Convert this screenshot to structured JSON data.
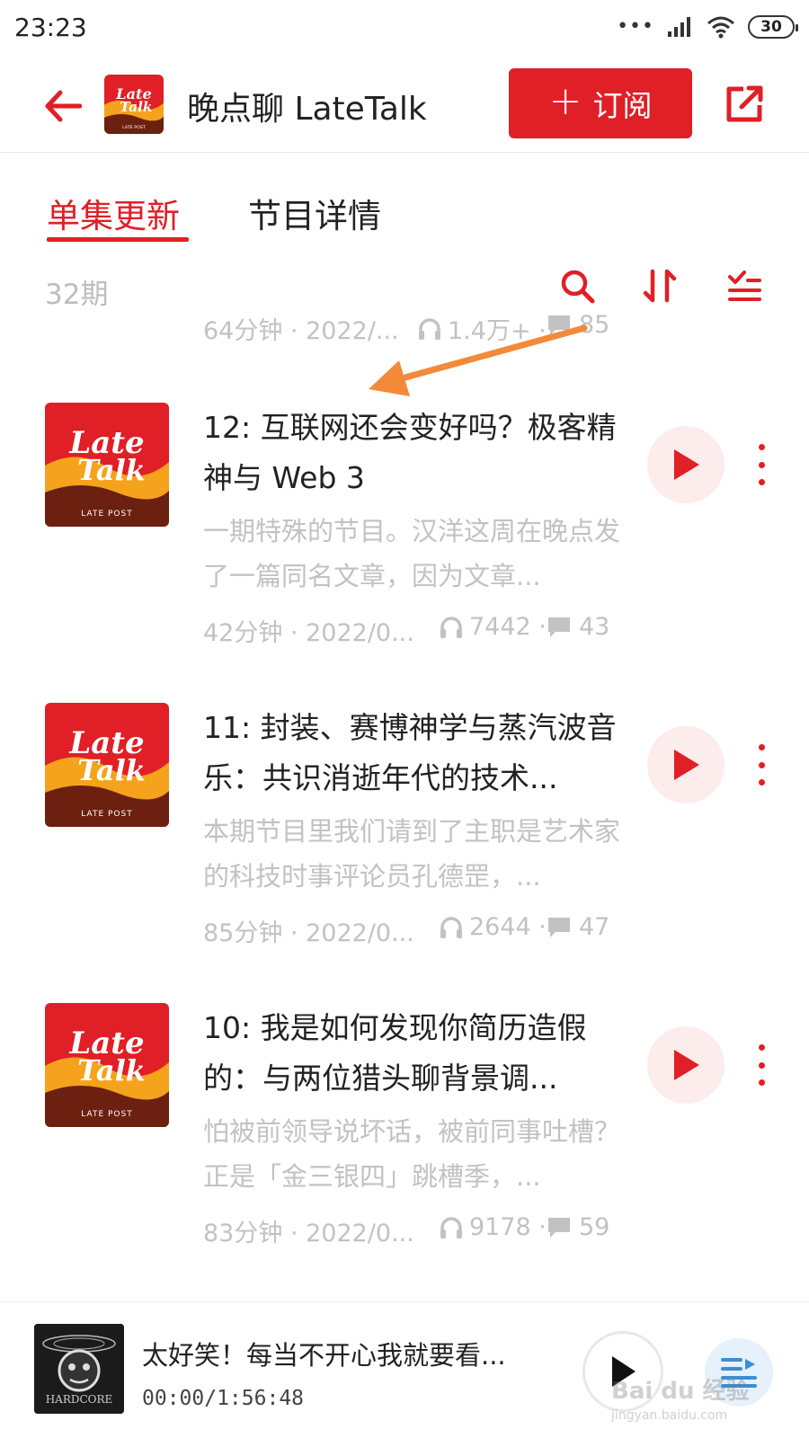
{
  "status_bar": {
    "time": "23:23",
    "signal_dots": "•••",
    "battery": "30"
  },
  "header": {
    "title": "晚点聊 LateTalk",
    "subscribe_label": "订阅",
    "subscribe_plus": "+"
  },
  "tabs": [
    {
      "label": "单集更新",
      "active": true
    },
    {
      "label": "节目详情",
      "active": false
    }
  ],
  "toolbar": {
    "count": "32期"
  },
  "partial_episode": {
    "duration": "64分钟 · 2022/...",
    "plays": "1.4万+ ·",
    "comments": "85"
  },
  "episodes": [
    {
      "title": "12: 互联网还会变好吗？极客精神与 Web 3",
      "desc": "一期特殊的节目。汉洋这周在晚点发了一篇同名文章，因为文章...",
      "duration": "42分钟 · 2022/0...",
      "plays": "7442 ·",
      "comments": "43"
    },
    {
      "title": "11: 封装、赛博神学与蒸汽波音乐：共识消逝年代的技术...",
      "desc": "本期节目里我们请到了主职是艺术家的科技时事评论员孔德罡，...",
      "duration": "85分钟 · 2022/0...",
      "plays": "2644 ·",
      "comments": "47"
    },
    {
      "title": "10: 我是如何发现你简历造假的：与两位猎头聊背景调...",
      "desc": "怕被前领导说坏话，被前同事吐槽？正是「金三银四」跳槽季，...",
      "duration": "83分钟 · 2022/0...",
      "plays": "9178 ·",
      "comments": "59"
    }
  ],
  "cover": {
    "line1": "Late",
    "line2": "Talk",
    "brand": "LATE POST"
  },
  "mini_player": {
    "title": "太好笑！每当不开心我就要看...",
    "time": "00:00/1:56:48",
    "cover_text": "HARDCORE"
  },
  "watermark": {
    "main": "Bai du 经验",
    "sub": "jingyan.baidu.com"
  },
  "colors": {
    "accent": "#e01f26",
    "muted": "#c2c2c2",
    "annotation": "#f28a3a"
  }
}
